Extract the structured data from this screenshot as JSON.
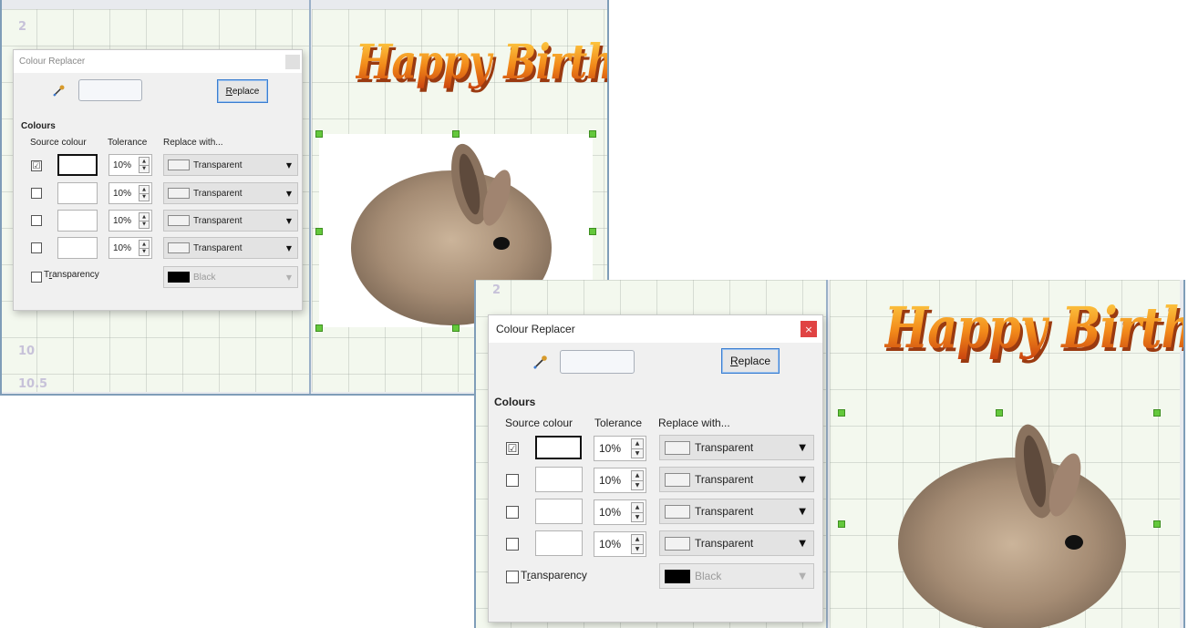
{
  "dialog": {
    "title": "Colour Replacer",
    "close_icon": "×",
    "replace_label_pre": "",
    "replace_label_u": "R",
    "replace_label_post": "eplace",
    "colours_heading": "Colours",
    "col_source": "Source colour",
    "col_tolerance": "Tolerance",
    "col_replace": "Replace with...",
    "rows": [
      {
        "checked": "☑",
        "tolerance": "10%",
        "replace": "Transparent"
      },
      {
        "checked": "",
        "tolerance": "10%",
        "replace": "Transparent"
      },
      {
        "checked": "",
        "tolerance": "10%",
        "replace": "Transparent"
      },
      {
        "checked": "",
        "tolerance": "10%",
        "replace": "Transparent"
      }
    ],
    "transparency_pre": "T",
    "transparency_u": "r",
    "transparency_post": "ansparency",
    "transparency_colour": "Black",
    "spin_up": "▲",
    "spin_down": "▼",
    "dropdown_arrow": "▼"
  },
  "document": {
    "wordart": "Happy Birthday",
    "ruler_2": "2",
    "ruler_10": "10",
    "ruler_10_5": "10.5"
  },
  "icons": {
    "pipette": "pipette-icon",
    "close": "close-icon"
  },
  "colors": {
    "accent": "#3b7ed0",
    "close": "#e04343",
    "handle": "#64c83c",
    "page_bg": "#f3f8ee"
  }
}
